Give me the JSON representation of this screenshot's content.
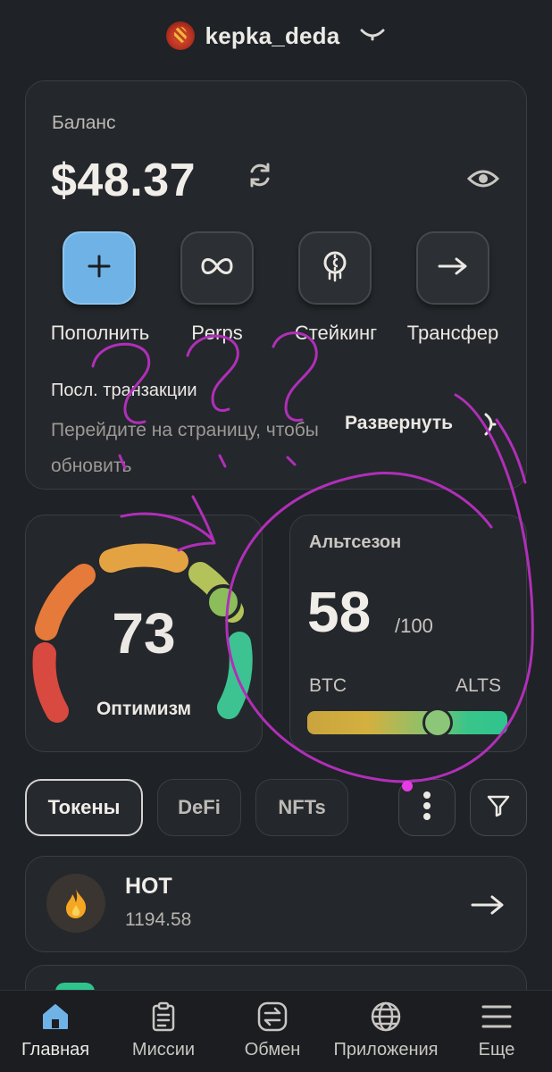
{
  "header": {
    "username": "kepka_deda"
  },
  "balance": {
    "label": "Баланс",
    "amount": "$48.37"
  },
  "actions": [
    {
      "label": "Пополнить",
      "icon": "plus-icon"
    },
    {
      "label": "Perps",
      "icon": "infinity-icon"
    },
    {
      "label": "Стейкинг",
      "icon": "coin-drip-icon"
    },
    {
      "label": "Трансфер",
      "icon": "arrow-right-icon"
    }
  ],
  "transactions": {
    "title": "Посл. транзакции",
    "description": "Перейдите на страницу, чтобы обновить",
    "expand_label": "Развернуть"
  },
  "optimism": {
    "value": "73",
    "label": "Оптимизм"
  },
  "altseason": {
    "title": "Альтсезон",
    "value": "58",
    "max": "/100",
    "left_label": "BTC",
    "right_label": "ALTS",
    "level": 0.58
  },
  "tabs": [
    {
      "label": "Токены",
      "active": true
    },
    {
      "label": "DeFi",
      "active": false
    },
    {
      "label": "NFTs",
      "active": false
    }
  ],
  "tokens": [
    {
      "name": "HOT",
      "amount": "1194.58",
      "icon": "flame-icon"
    }
  ],
  "nav": [
    {
      "label": "Главная",
      "icon": "home-icon",
      "active": true
    },
    {
      "label": "Миссии",
      "icon": "clipboard-icon",
      "active": false
    },
    {
      "label": "Обмен",
      "icon": "swap-icon",
      "active": false
    },
    {
      "label": "Приложения",
      "icon": "globe-icon",
      "active": false
    },
    {
      "label": "Еще",
      "icon": "menu-icon",
      "active": false
    }
  ],
  "colors": {
    "background": "#1f2226",
    "card": "#24272b",
    "primary_button": "#6fb2e6",
    "scribble": "#b02fb8"
  }
}
